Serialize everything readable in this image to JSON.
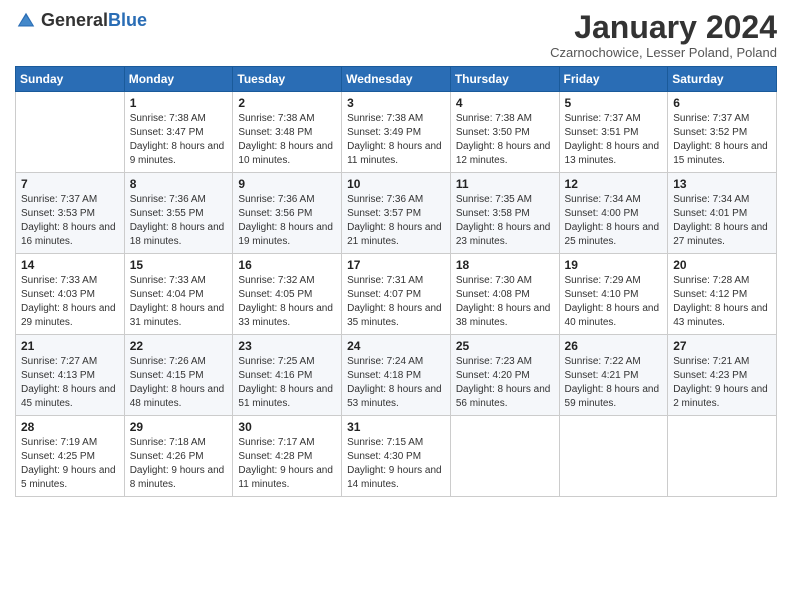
{
  "header": {
    "logo_general": "General",
    "logo_blue": "Blue",
    "month_title": "January 2024",
    "location": "Czarnochowice, Lesser Poland, Poland"
  },
  "weekdays": [
    "Sunday",
    "Monday",
    "Tuesday",
    "Wednesday",
    "Thursday",
    "Friday",
    "Saturday"
  ],
  "weeks": [
    [
      {
        "day": "",
        "sunrise": "",
        "sunset": "",
        "daylight": ""
      },
      {
        "day": "1",
        "sunrise": "Sunrise: 7:38 AM",
        "sunset": "Sunset: 3:47 PM",
        "daylight": "Daylight: 8 hours and 9 minutes."
      },
      {
        "day": "2",
        "sunrise": "Sunrise: 7:38 AM",
        "sunset": "Sunset: 3:48 PM",
        "daylight": "Daylight: 8 hours and 10 minutes."
      },
      {
        "day": "3",
        "sunrise": "Sunrise: 7:38 AM",
        "sunset": "Sunset: 3:49 PM",
        "daylight": "Daylight: 8 hours and 11 minutes."
      },
      {
        "day": "4",
        "sunrise": "Sunrise: 7:38 AM",
        "sunset": "Sunset: 3:50 PM",
        "daylight": "Daylight: 8 hours and 12 minutes."
      },
      {
        "day": "5",
        "sunrise": "Sunrise: 7:37 AM",
        "sunset": "Sunset: 3:51 PM",
        "daylight": "Daylight: 8 hours and 13 minutes."
      },
      {
        "day": "6",
        "sunrise": "Sunrise: 7:37 AM",
        "sunset": "Sunset: 3:52 PM",
        "daylight": "Daylight: 8 hours and 15 minutes."
      }
    ],
    [
      {
        "day": "7",
        "sunrise": "Sunrise: 7:37 AM",
        "sunset": "Sunset: 3:53 PM",
        "daylight": "Daylight: 8 hours and 16 minutes."
      },
      {
        "day": "8",
        "sunrise": "Sunrise: 7:36 AM",
        "sunset": "Sunset: 3:55 PM",
        "daylight": "Daylight: 8 hours and 18 minutes."
      },
      {
        "day": "9",
        "sunrise": "Sunrise: 7:36 AM",
        "sunset": "Sunset: 3:56 PM",
        "daylight": "Daylight: 8 hours and 19 minutes."
      },
      {
        "day": "10",
        "sunrise": "Sunrise: 7:36 AM",
        "sunset": "Sunset: 3:57 PM",
        "daylight": "Daylight: 8 hours and 21 minutes."
      },
      {
        "day": "11",
        "sunrise": "Sunrise: 7:35 AM",
        "sunset": "Sunset: 3:58 PM",
        "daylight": "Daylight: 8 hours and 23 minutes."
      },
      {
        "day": "12",
        "sunrise": "Sunrise: 7:34 AM",
        "sunset": "Sunset: 4:00 PM",
        "daylight": "Daylight: 8 hours and 25 minutes."
      },
      {
        "day": "13",
        "sunrise": "Sunrise: 7:34 AM",
        "sunset": "Sunset: 4:01 PM",
        "daylight": "Daylight: 8 hours and 27 minutes."
      }
    ],
    [
      {
        "day": "14",
        "sunrise": "Sunrise: 7:33 AM",
        "sunset": "Sunset: 4:03 PM",
        "daylight": "Daylight: 8 hours and 29 minutes."
      },
      {
        "day": "15",
        "sunrise": "Sunrise: 7:33 AM",
        "sunset": "Sunset: 4:04 PM",
        "daylight": "Daylight: 8 hours and 31 minutes."
      },
      {
        "day": "16",
        "sunrise": "Sunrise: 7:32 AM",
        "sunset": "Sunset: 4:05 PM",
        "daylight": "Daylight: 8 hours and 33 minutes."
      },
      {
        "day": "17",
        "sunrise": "Sunrise: 7:31 AM",
        "sunset": "Sunset: 4:07 PM",
        "daylight": "Daylight: 8 hours and 35 minutes."
      },
      {
        "day": "18",
        "sunrise": "Sunrise: 7:30 AM",
        "sunset": "Sunset: 4:08 PM",
        "daylight": "Daylight: 8 hours and 38 minutes."
      },
      {
        "day": "19",
        "sunrise": "Sunrise: 7:29 AM",
        "sunset": "Sunset: 4:10 PM",
        "daylight": "Daylight: 8 hours and 40 minutes."
      },
      {
        "day": "20",
        "sunrise": "Sunrise: 7:28 AM",
        "sunset": "Sunset: 4:12 PM",
        "daylight": "Daylight: 8 hours and 43 minutes."
      }
    ],
    [
      {
        "day": "21",
        "sunrise": "Sunrise: 7:27 AM",
        "sunset": "Sunset: 4:13 PM",
        "daylight": "Daylight: 8 hours and 45 minutes."
      },
      {
        "day": "22",
        "sunrise": "Sunrise: 7:26 AM",
        "sunset": "Sunset: 4:15 PM",
        "daylight": "Daylight: 8 hours and 48 minutes."
      },
      {
        "day": "23",
        "sunrise": "Sunrise: 7:25 AM",
        "sunset": "Sunset: 4:16 PM",
        "daylight": "Daylight: 8 hours and 51 minutes."
      },
      {
        "day": "24",
        "sunrise": "Sunrise: 7:24 AM",
        "sunset": "Sunset: 4:18 PM",
        "daylight": "Daylight: 8 hours and 53 minutes."
      },
      {
        "day": "25",
        "sunrise": "Sunrise: 7:23 AM",
        "sunset": "Sunset: 4:20 PM",
        "daylight": "Daylight: 8 hours and 56 minutes."
      },
      {
        "day": "26",
        "sunrise": "Sunrise: 7:22 AM",
        "sunset": "Sunset: 4:21 PM",
        "daylight": "Daylight: 8 hours and 59 minutes."
      },
      {
        "day": "27",
        "sunrise": "Sunrise: 7:21 AM",
        "sunset": "Sunset: 4:23 PM",
        "daylight": "Daylight: 9 hours and 2 minutes."
      }
    ],
    [
      {
        "day": "28",
        "sunrise": "Sunrise: 7:19 AM",
        "sunset": "Sunset: 4:25 PM",
        "daylight": "Daylight: 9 hours and 5 minutes."
      },
      {
        "day": "29",
        "sunrise": "Sunrise: 7:18 AM",
        "sunset": "Sunset: 4:26 PM",
        "daylight": "Daylight: 9 hours and 8 minutes."
      },
      {
        "day": "30",
        "sunrise": "Sunrise: 7:17 AM",
        "sunset": "Sunset: 4:28 PM",
        "daylight": "Daylight: 9 hours and 11 minutes."
      },
      {
        "day": "31",
        "sunrise": "Sunrise: 7:15 AM",
        "sunset": "Sunset: 4:30 PM",
        "daylight": "Daylight: 9 hours and 14 minutes."
      },
      {
        "day": "",
        "sunrise": "",
        "sunset": "",
        "daylight": ""
      },
      {
        "day": "",
        "sunrise": "",
        "sunset": "",
        "daylight": ""
      },
      {
        "day": "",
        "sunrise": "",
        "sunset": "",
        "daylight": ""
      }
    ]
  ]
}
